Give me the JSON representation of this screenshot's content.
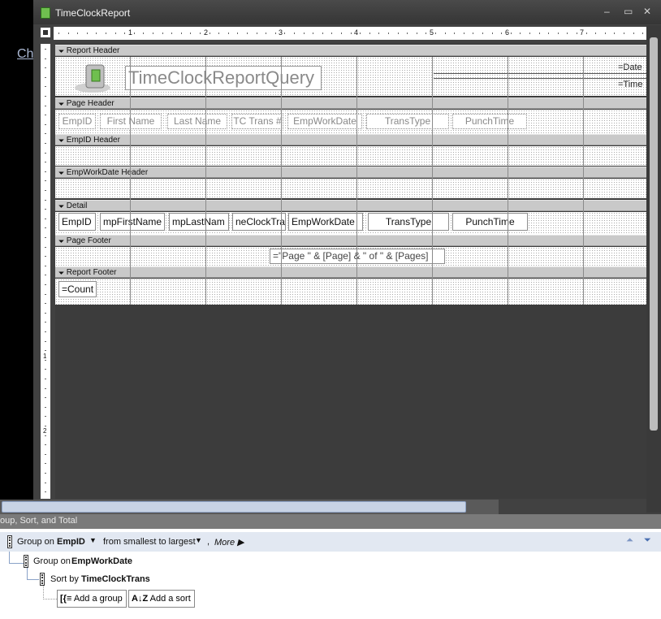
{
  "background": {
    "link_fragment": "Ch"
  },
  "window": {
    "title": "TimeClockReport",
    "minimize": "–",
    "restore": "▭",
    "close": "✕"
  },
  "ruler": {
    "h_numbers": [
      "1",
      "2",
      "3",
      "4",
      "5",
      "6",
      "7"
    ],
    "v_numbers": [
      "1",
      "2"
    ]
  },
  "sections": {
    "report_header": "Report Header",
    "page_header": "Page Header",
    "empid_header": "EmpID Header",
    "empworkdate_header": "EmpWorkDate Header",
    "detail": "Detail",
    "page_footer": "Page Footer",
    "report_footer": "Report Footer"
  },
  "report_header": {
    "title": "TimeClockReportQuery",
    "date": "=Date",
    "time": "=Time"
  },
  "page_header": {
    "labels": [
      "EmpID",
      "First Name",
      "Last Name",
      "TC Trans #",
      "EmpWorkDate",
      "TransType",
      "PunchTime"
    ]
  },
  "detail": {
    "fields": [
      "EmpID",
      "mpFirstName",
      "mpLastNam",
      "neClockTra",
      "EmpWorkDate",
      "TransType",
      "PunchTime"
    ]
  },
  "page_footer": {
    "expression": "=\"Page \" & [Page] & \" of \" & [Pages]"
  },
  "report_footer": {
    "expression": "=Count"
  },
  "group_sort": {
    "title": "oup, Sort, and Total",
    "row1": {
      "prefix": "Group on",
      "field": "EmpID",
      "order": "from smallest to largest",
      "more": "More ▶"
    },
    "row2": {
      "prefix": "Group on",
      "field": "EmpWorkDate"
    },
    "row3": {
      "prefix": "Sort by",
      "field": "TimeClockTrans"
    },
    "add_group": "Add a group",
    "add_sort": "Add a sort",
    "add_group_icon": "[{≡",
    "add_sort_icon": "A↓Z"
  }
}
